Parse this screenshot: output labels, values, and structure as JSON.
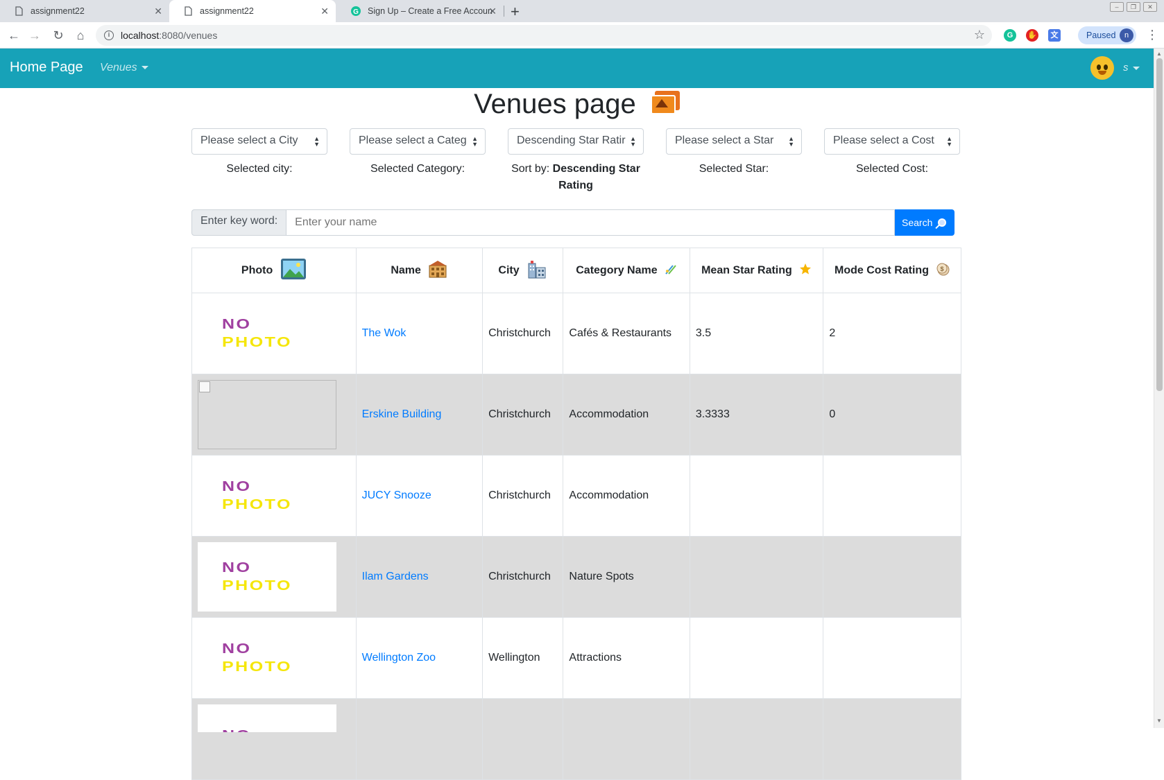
{
  "browser": {
    "tabs": [
      {
        "title": "assignment22",
        "active": false
      },
      {
        "title": "assignment22",
        "active": true
      },
      {
        "title": "Sign Up – Create a Free Accoun",
        "active": false
      }
    ],
    "url_host": "localhost",
    "url_path": ":8080/venues",
    "profile_status": "Paused",
    "profile_initial": "n"
  },
  "navbar": {
    "brand": "Home Page",
    "venues_menu": "Venues",
    "user_name": "s"
  },
  "page": {
    "title": "Venues page"
  },
  "filters": {
    "city": {
      "value": "Please select a City",
      "label": "Selected city:"
    },
    "category": {
      "value": "Please select a Categ",
      "label": "Selected Category:"
    },
    "sort": {
      "value": "Descending Star Ratir",
      "label_prefix": "Sort by: ",
      "label_value": "Descending Star Rating"
    },
    "star": {
      "value": "Please select a Star",
      "label": "Selected Star:"
    },
    "cost": {
      "value": "Please select a Cost",
      "label": "Selected Cost:"
    }
  },
  "search": {
    "prepend": "Enter key word:",
    "placeholder": "Enter your name",
    "button": "Search"
  },
  "table": {
    "headers": [
      "Photo",
      "Name",
      "City",
      "Category Name",
      "Mean Star Rating",
      "Mode Cost Rating"
    ],
    "no_photo_top": "NO",
    "no_photo_bottom": "PHOTO",
    "rows": [
      {
        "photo": "none",
        "name": "The Wok",
        "city": "Christchurch",
        "category": "Cafés & Restaurants",
        "mean_star": "3.5",
        "mode_cost": "2"
      },
      {
        "photo": "broken",
        "name": "Erskine Building",
        "city": "Christchurch",
        "category": "Accommodation",
        "mean_star": "3.3333",
        "mode_cost": "0"
      },
      {
        "photo": "none",
        "name": "JUCY Snooze",
        "city": "Christchurch",
        "category": "Accommodation",
        "mean_star": "",
        "mode_cost": ""
      },
      {
        "photo": "none",
        "name": "Ilam Gardens",
        "city": "Christchurch",
        "category": "Nature Spots",
        "mean_star": "",
        "mode_cost": ""
      },
      {
        "photo": "none",
        "name": "Wellington Zoo",
        "city": "Wellington",
        "category": "Attractions",
        "mean_star": "",
        "mode_cost": ""
      }
    ]
  },
  "colors": {
    "navbar": "#17a2b8",
    "link": "#007bff",
    "alt_row": "#dcdcdc"
  }
}
